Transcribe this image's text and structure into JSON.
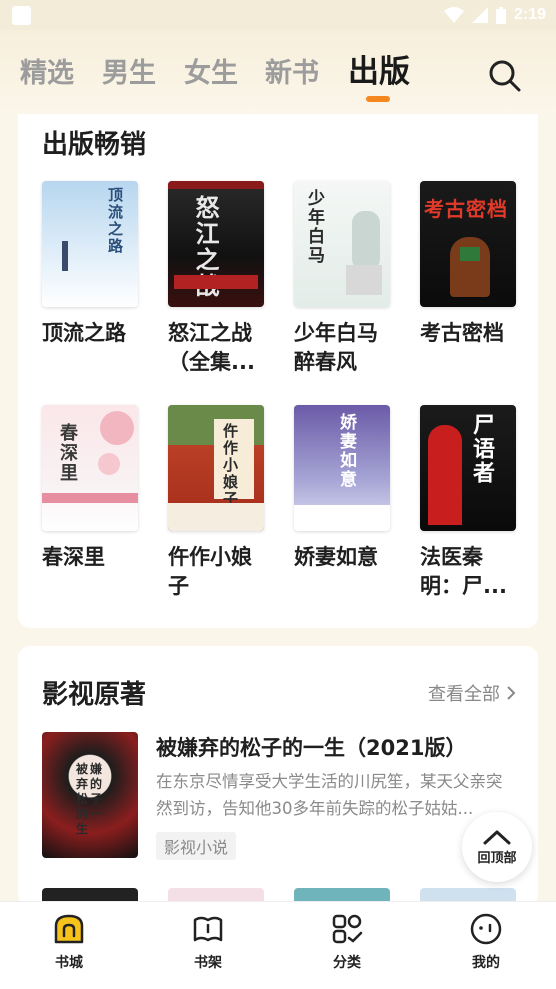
{
  "status_bar": {
    "time": "2:19"
  },
  "tabs": [
    {
      "label": "精选",
      "active": false
    },
    {
      "label": "男生",
      "active": false
    },
    {
      "label": "女生",
      "active": false
    },
    {
      "label": "新书",
      "active": false
    },
    {
      "label": "出版",
      "active": true
    }
  ],
  "search": {
    "icon": "search-icon"
  },
  "publish_section": {
    "title": "出版畅销",
    "books": [
      {
        "title": "顶流之路",
        "cover_text": "顶流之路"
      },
      {
        "title": "怒江之战\n（全集...",
        "cover_text": "怒江之战"
      },
      {
        "title": "少年白马\n醉春风",
        "cover_text": "少年白马"
      },
      {
        "title": "考古密档",
        "cover_text": "考古密档"
      },
      {
        "title": "春深里",
        "cover_text": "春深里"
      },
      {
        "title": "仵作小娘\n子",
        "cover_text": "仵作小娘子"
      },
      {
        "title": "娇妻如意",
        "cover_text": "娇妻如意"
      },
      {
        "title": "法医秦\n明：尸...",
        "cover_text": "尸语者"
      }
    ]
  },
  "film_section": {
    "title": "影视原著",
    "view_all": "查看全部",
    "item": {
      "title": "被嫌弃的松子的一生（2021版）",
      "description": "在东京尽情享受大学生活的川尻笙，某天父亲突然到访，告知他30多年前失踪的松子姑姑...",
      "tag": "影视小说",
      "cover_text": "被嫌弃的松子的一生"
    }
  },
  "back_to_top": {
    "label": "回顶部"
  },
  "bottom_nav": [
    {
      "label": "书城",
      "icon": "bookstore-icon"
    },
    {
      "label": "书架",
      "icon": "bookshelf-icon"
    },
    {
      "label": "分类",
      "icon": "category-icon"
    },
    {
      "label": "我的",
      "icon": "profile-icon"
    }
  ],
  "colors": {
    "accent": "#f5871f",
    "nav_active": "#f7c21c"
  }
}
